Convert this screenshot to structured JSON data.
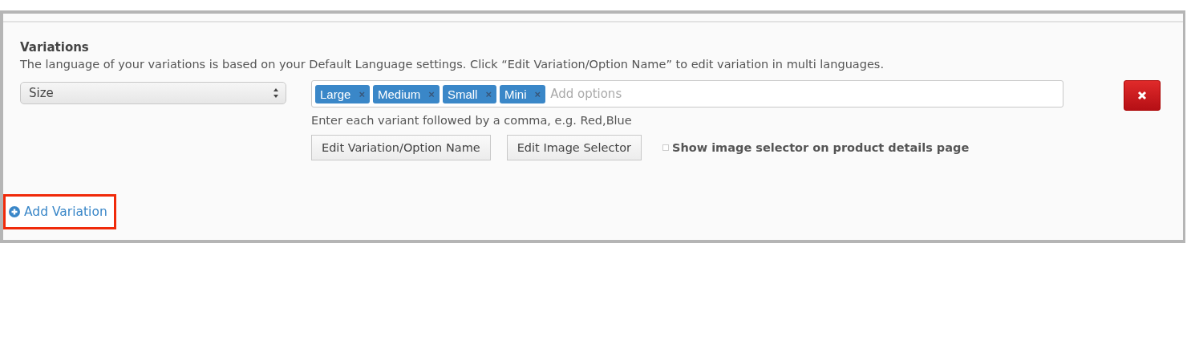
{
  "section": {
    "title": "Variations",
    "description": "The language of your variations is based on your Default Language settings. Click “Edit Variation/Option Name” to edit variation in multi languages."
  },
  "variations": [
    {
      "type": "Size",
      "options": [
        {
          "label": "Large",
          "remove": "×"
        },
        {
          "label": "Medium",
          "remove": "×"
        },
        {
          "label": "Small",
          "remove": "×"
        },
        {
          "label": "Mini",
          "remove": "×"
        }
      ],
      "placeholder": "Add options",
      "hint": "Enter each variant followed by a comma, e.g. Red,Blue",
      "buttons": [
        "Edit Variation/Option Name",
        "Edit Image Selector"
      ],
      "show_image_selector": {
        "label": "Show image selector on product details page",
        "checked": false
      }
    }
  ],
  "add_variation": {
    "label": "Add Variation",
    "highlighted": true
  }
}
